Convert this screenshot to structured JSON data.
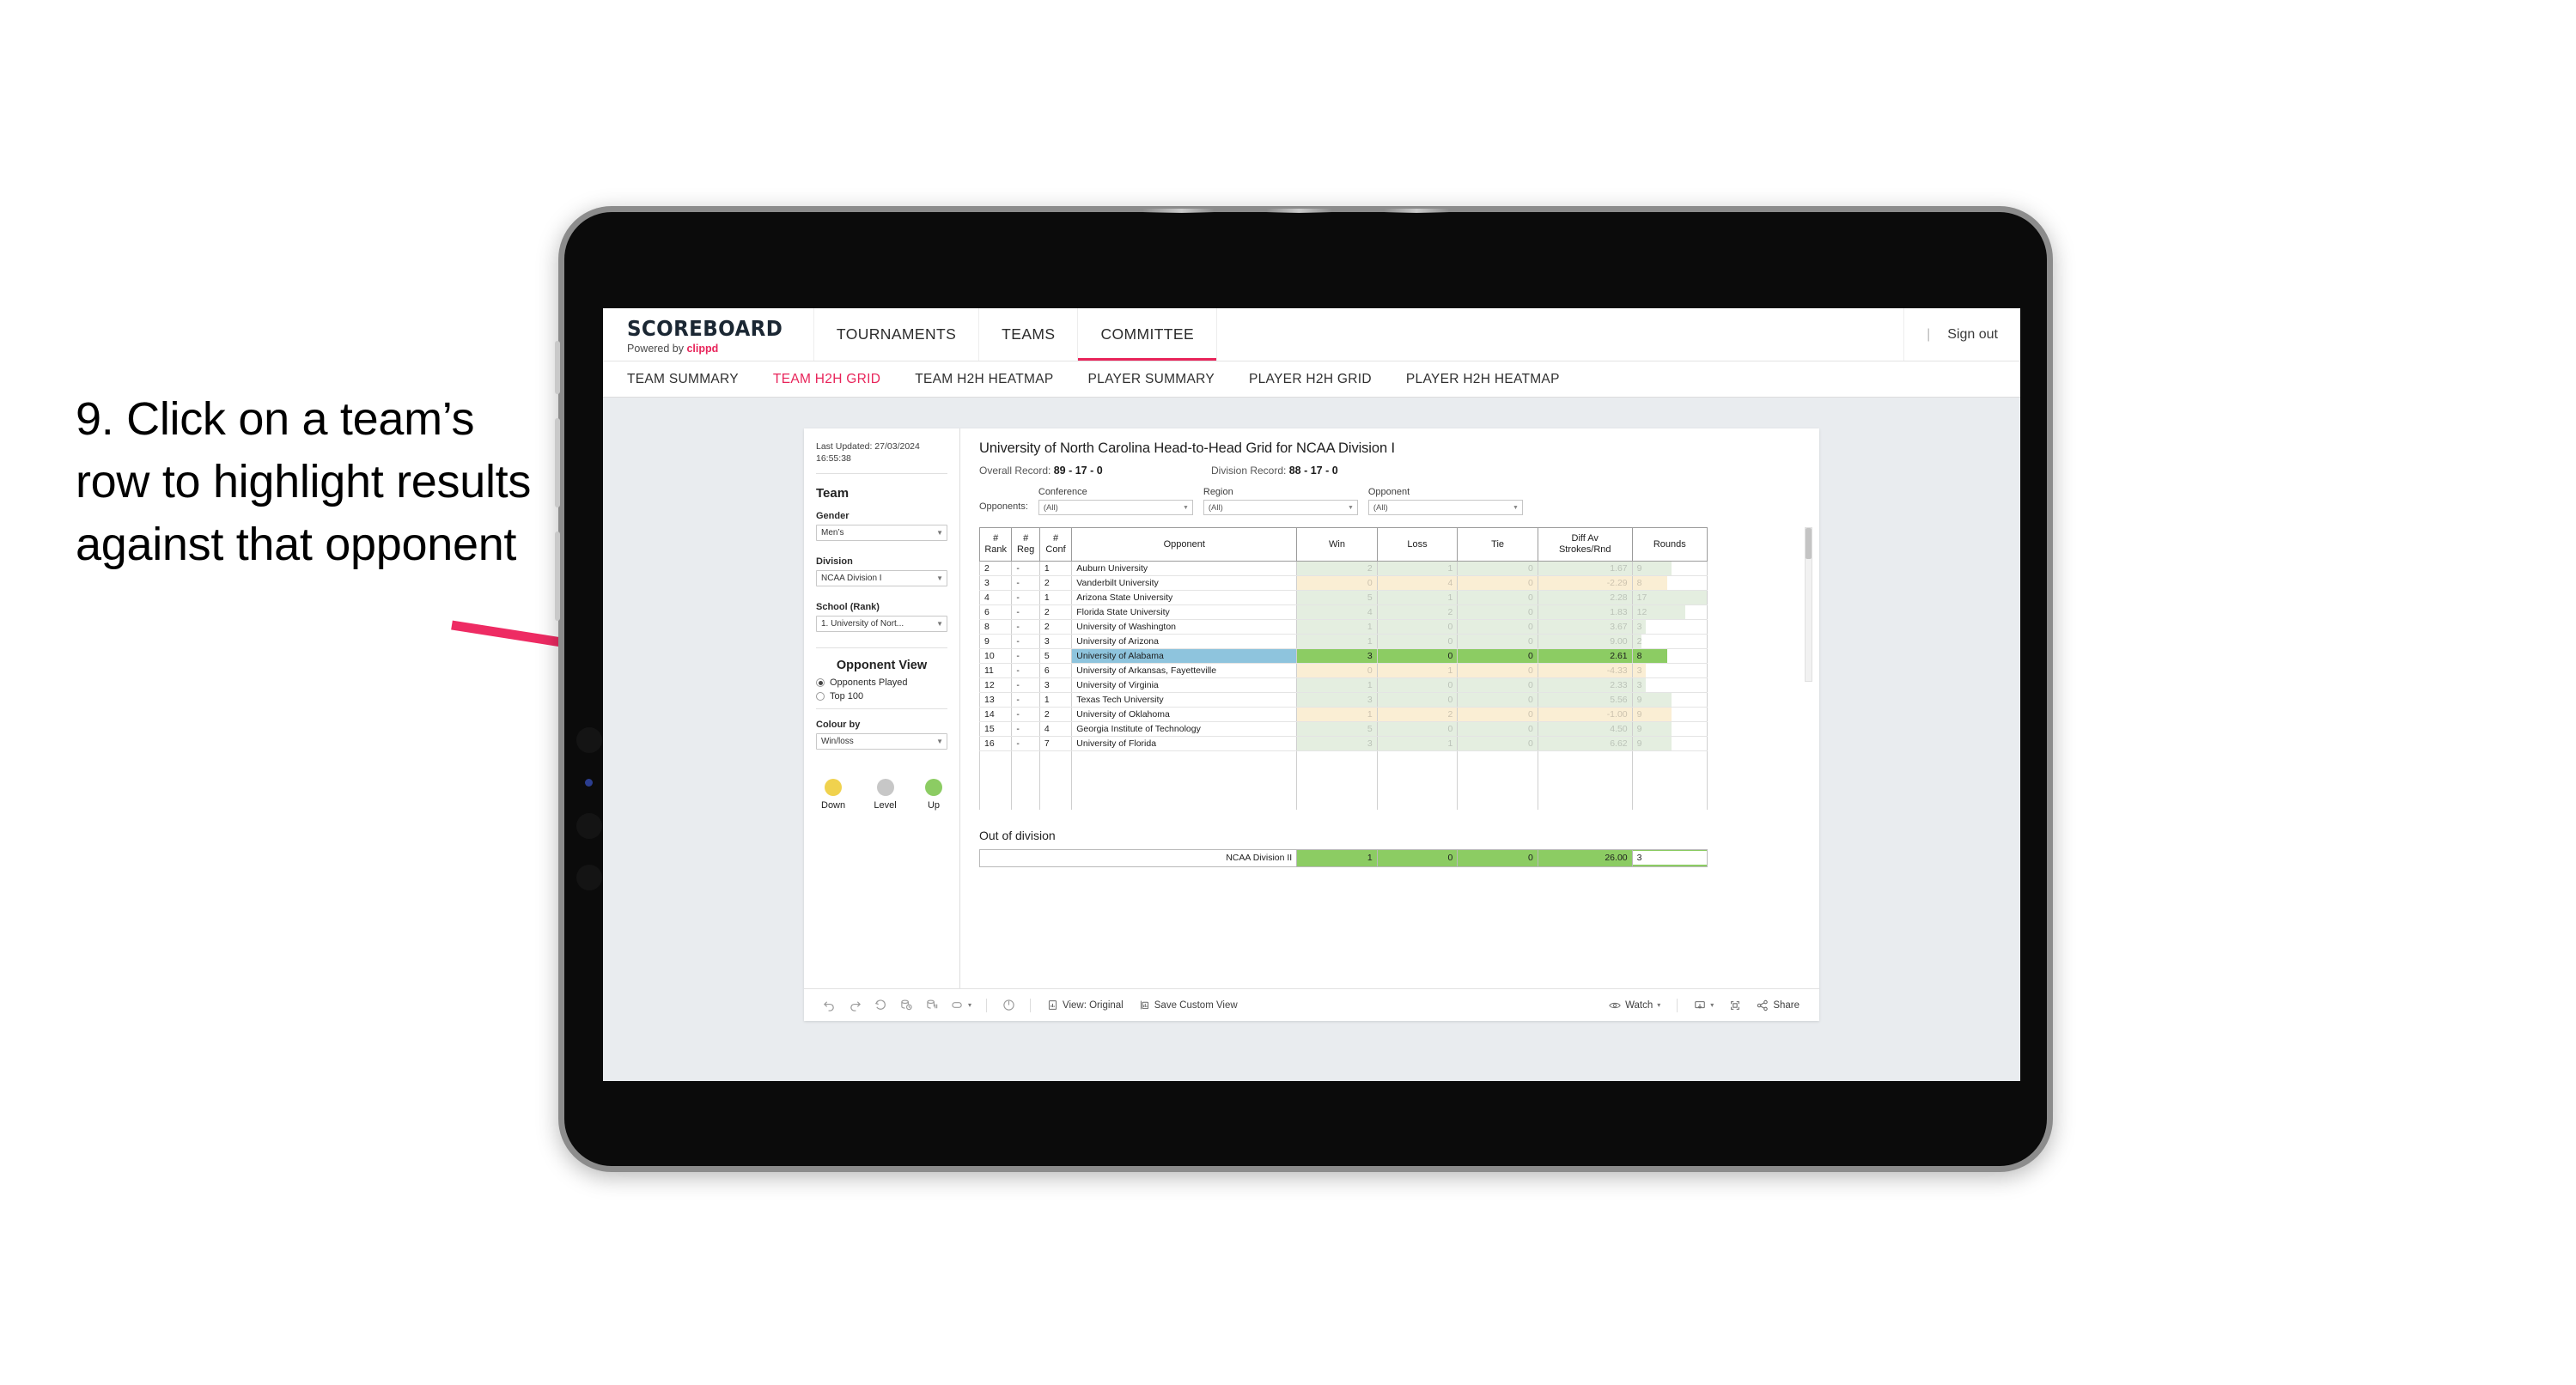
{
  "caption": {
    "text": "9. Click on a team’s row to highlight results against that opponent"
  },
  "app": {
    "brand_title": "SCOREBOARD",
    "brand_sub_prefix": "Powered by ",
    "brand_sub_name": "clippd",
    "nav": [
      {
        "label": "TOURNAMENTS",
        "active": false
      },
      {
        "label": "TEAMS",
        "active": false
      },
      {
        "label": "COMMITTEE",
        "active": true
      }
    ],
    "signout_sep": "|",
    "signout": "Sign out",
    "subnav": [
      {
        "label": "TEAM SUMMARY",
        "active": false
      },
      {
        "label": "TEAM H2H GRID",
        "active": true
      },
      {
        "label": "TEAM H2H HEATMAP",
        "active": false
      },
      {
        "label": "PLAYER SUMMARY",
        "active": false
      },
      {
        "label": "PLAYER H2H GRID",
        "active": false
      },
      {
        "label": "PLAYER H2H HEATMAP",
        "active": false
      }
    ]
  },
  "filters": {
    "last_updated": "Last Updated: 27/03/2024 16:55:38",
    "team_heading": "Team",
    "gender_label": "Gender",
    "gender_value": "Men’s",
    "division_label": "Division",
    "division_value": "NCAA Division I",
    "school_label": "School (Rank)",
    "school_value": "1. University of Nort...",
    "opponent_view_heading": "Opponent View",
    "opponent_view_options": [
      {
        "label": "Opponents Played",
        "selected": true
      },
      {
        "label": "Top 100",
        "selected": false
      }
    ],
    "colour_by_label": "Colour by",
    "colour_by_value": "Win/loss",
    "legend": [
      {
        "label": "Down",
        "color": "#f0d24e"
      },
      {
        "label": "Level",
        "color": "#c7c7c7"
      },
      {
        "label": "Up",
        "color": "#8ccc63"
      }
    ]
  },
  "viz": {
    "title": "University of North Carolina Head-to-Head Grid for NCAA Division I",
    "overall_record_label": "Overall Record:",
    "overall_record_value": "89 - 17 - 0",
    "division_record_label": "Division Record:",
    "division_record_value": "88 - 17 - 0",
    "opponents_label": "Opponents:",
    "opponent_filters": [
      {
        "label": "Conference",
        "value": "(All)"
      },
      {
        "label": "Region",
        "value": "(All)"
      },
      {
        "label": "Opponent",
        "value": "(All)"
      }
    ],
    "columns": {
      "rank": "# Rank",
      "reg": "# Reg",
      "conf": "# Conf",
      "opponent": "Opponent",
      "win": "Win",
      "loss": "Loss",
      "tie": "Tie",
      "diff": "Diff Av Strokes/Rnd",
      "rounds": "Rounds"
    },
    "rows": [
      {
        "rank": "2",
        "reg": "-",
        "conf": "1",
        "opponent": "Auburn University",
        "win": "2",
        "loss": "1",
        "tie": "0",
        "diff": "1.67",
        "rounds": "9",
        "tone": "green",
        "selected": false
      },
      {
        "rank": "3",
        "reg": "-",
        "conf": "2",
        "opponent": "Vanderbilt University",
        "win": "0",
        "loss": "4",
        "tie": "0",
        "diff": "-2.29",
        "rounds": "8",
        "tone": "amber",
        "selected": false
      },
      {
        "rank": "4",
        "reg": "-",
        "conf": "1",
        "opponent": "Arizona State University",
        "win": "5",
        "loss": "1",
        "tie": "0",
        "diff": "2.28",
        "rounds": "17",
        "tone": "green",
        "selected": false
      },
      {
        "rank": "6",
        "reg": "-",
        "conf": "2",
        "opponent": "Florida State University",
        "win": "4",
        "loss": "2",
        "tie": "0",
        "diff": "1.83",
        "rounds": "12",
        "tone": "green",
        "selected": false
      },
      {
        "rank": "8",
        "reg": "-",
        "conf": "2",
        "opponent": "University of Washington",
        "win": "1",
        "loss": "0",
        "tie": "0",
        "diff": "3.67",
        "rounds": "3",
        "tone": "green",
        "selected": false
      },
      {
        "rank": "9",
        "reg": "-",
        "conf": "3",
        "opponent": "University of Arizona",
        "win": "1",
        "loss": "0",
        "tie": "0",
        "diff": "9.00",
        "rounds": "2",
        "tone": "green",
        "selected": false
      },
      {
        "rank": "10",
        "reg": "-",
        "conf": "5",
        "opponent": "University of Alabama",
        "win": "3",
        "loss": "0",
        "tie": "0",
        "diff": "2.61",
        "rounds": "8",
        "tone": "green",
        "selected": true
      },
      {
        "rank": "11",
        "reg": "-",
        "conf": "6",
        "opponent": "University of Arkansas, Fayetteville",
        "win": "0",
        "loss": "1",
        "tie": "0",
        "diff": "-4.33",
        "rounds": "3",
        "tone": "amber",
        "selected": false
      },
      {
        "rank": "12",
        "reg": "-",
        "conf": "3",
        "opponent": "University of Virginia",
        "win": "1",
        "loss": "0",
        "tie": "0",
        "diff": "2.33",
        "rounds": "3",
        "tone": "green",
        "selected": false
      },
      {
        "rank": "13",
        "reg": "-",
        "conf": "1",
        "opponent": "Texas Tech University",
        "win": "3",
        "loss": "0",
        "tie": "0",
        "diff": "5.56",
        "rounds": "9",
        "tone": "green",
        "selected": false
      },
      {
        "rank": "14",
        "reg": "-",
        "conf": "2",
        "opponent": "University of Oklahoma",
        "win": "1",
        "loss": "2",
        "tie": "0",
        "diff": "-1.00",
        "rounds": "9",
        "tone": "amber",
        "selected": false
      },
      {
        "rank": "15",
        "reg": "-",
        "conf": "4",
        "opponent": "Georgia Institute of Technology",
        "win": "5",
        "loss": "0",
        "tie": "0",
        "diff": "4.50",
        "rounds": "9",
        "tone": "green",
        "selected": false
      },
      {
        "rank": "16",
        "reg": "-",
        "conf": "7",
        "opponent": "University of Florida",
        "win": "3",
        "loss": "1",
        "tie": "0",
        "diff": "6.62",
        "rounds": "9",
        "tone": "green",
        "selected": false
      }
    ],
    "out_of_division_title": "Out of division",
    "out_of_division_row": {
      "name": "NCAA Division II",
      "win": "1",
      "loss": "0",
      "tie": "0",
      "diff": "26.00",
      "rounds": "3"
    }
  },
  "toolbar": {
    "view_original": "View: Original",
    "save_custom_view": "Save Custom View",
    "watch": "Watch",
    "share": "Share",
    "caret": "▾"
  },
  "colors": {
    "accent": "#e8245a",
    "selected_row": "#8ec4dd",
    "selected_green": "#8ccc63",
    "green_dim": "#e4eee0",
    "amber_dim": "#faeed4"
  }
}
